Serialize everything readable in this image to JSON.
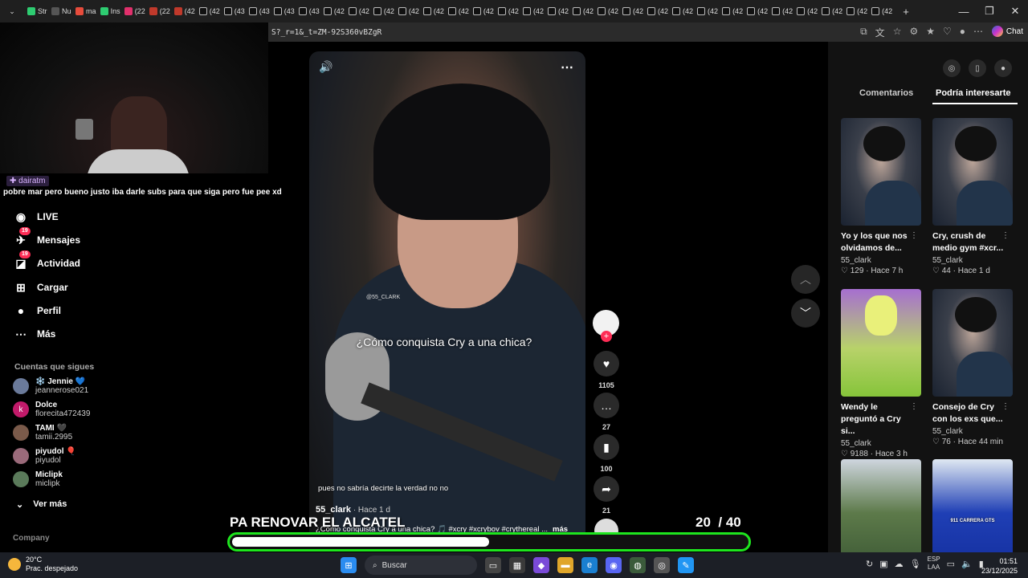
{
  "browser": {
    "tabs": [
      "Str",
      "Nu",
      "ma",
      "Ins",
      "(22",
      "(22",
      "(42",
      "(42",
      "(43",
      "(43",
      "(43",
      "(43",
      "(42",
      "(42",
      "(42",
      "(42",
      "(42",
      "(42",
      "(42",
      "(42",
      "(42",
      "(42",
      "(42",
      "(42",
      "(42",
      "(42",
      "(42",
      "(42",
      "(42",
      "(42",
      "(42",
      "(42",
      "(42",
      "(42",
      "(42"
    ],
    "url": "S?_r=1&_t=ZM-92S360vBZgR",
    "chat_label": "Chat",
    "new_tab": "+",
    "window_controls": [
      "—",
      "❐",
      "✕"
    ]
  },
  "stream_chat": {
    "username": "dairatm",
    "message": "pobre mar pero bueno justo iba darle subs para que siga pero fue pee xd"
  },
  "sidebar": {
    "items": [
      {
        "label": "LIVE",
        "icon": "live-icon",
        "badge": ""
      },
      {
        "label": "Mensajes",
        "icon": "message-icon",
        "badge": "19"
      },
      {
        "label": "Actividad",
        "icon": "activity-icon",
        "badge": "19"
      },
      {
        "label": "Cargar",
        "icon": "upload-icon",
        "badge": ""
      },
      {
        "label": "Perfil",
        "icon": "profile-icon",
        "badge": ""
      },
      {
        "label": "Más",
        "icon": "more-icon",
        "badge": ""
      }
    ],
    "following_title": "Cuentas que sigues",
    "following": [
      {
        "name": "❄️ Jennie 💙",
        "handle": "jeannerose021",
        "avatar": ""
      },
      {
        "name": "Dolce",
        "handle": "florecita472439",
        "avatar": "k"
      },
      {
        "name": "TAMI 🖤",
        "handle": "tamii.2995",
        "avatar": ""
      },
      {
        "name": "piyudol 🎈",
        "handle": "piyudol",
        "avatar": ""
      },
      {
        "name": "Miclipk",
        "handle": "miclipk",
        "avatar": ""
      }
    ],
    "see_more": "Ver más",
    "company": "Company"
  },
  "video": {
    "watermark": "@55_CLARK",
    "caption": "¿Cómo conquista Cry a una chica?",
    "subtitle": "pues no sabría decirte la verdad no no",
    "author": "55_clark",
    "time": " · Hace 1 d",
    "description": "¿Cómo conquista Cry a una chica? 🎵 #xcry #xcrybov #crythereal ...",
    "more": "más",
    "likes": "1105",
    "comments": "27",
    "saves": "100",
    "shares": "21"
  },
  "overlay": {
    "title": "PA RENOVAR EL ALCATEL",
    "goal_current": "20",
    "goal_total": "/ 40",
    "goal_progress": 0.5
  },
  "right_panel": {
    "tabs": [
      "Comentarios",
      "Podría interesarte"
    ],
    "active_tab": "Podría interesarte",
    "cards": [
      {
        "title": "Yo y los que nos olvidamos de...",
        "author": "55_clark",
        "likes": "129",
        "time": "Hace 7 h",
        "thumb": "cry",
        "thumb_text": ""
      },
      {
        "title": "Cry, crush de medio gym #xcr...",
        "author": "55_clark",
        "likes": "44",
        "time": "Hace 1 d",
        "thumb": "cry",
        "thumb_text": ""
      },
      {
        "title": "Wendy le preguntó a Cry si...",
        "author": "55_clark",
        "likes": "9188",
        "time": "Hace 3 h",
        "thumb": "wendy",
        "thumb_text": ""
      },
      {
        "title": "Consejo de Cry con los exs que...",
        "author": "55_clark",
        "likes": "76",
        "time": "Hace 44 min",
        "thumb": "cry",
        "thumb_text": ""
      },
      {
        "title": "",
        "author": "",
        "likes": "",
        "time": "",
        "thumb": "road",
        "thumb_text": ""
      },
      {
        "title": "",
        "author": "",
        "likes": "",
        "time": "",
        "thumb": "car",
        "thumb_text": "911 CARRERA GTS"
      }
    ]
  },
  "taskbar": {
    "temperature": "20°C",
    "weather": "Prac. despejado",
    "search_placeholder": "Buscar",
    "lang": "ESP",
    "lang2": "LAA",
    "time": "01:51",
    "date": "23/12/2025"
  }
}
